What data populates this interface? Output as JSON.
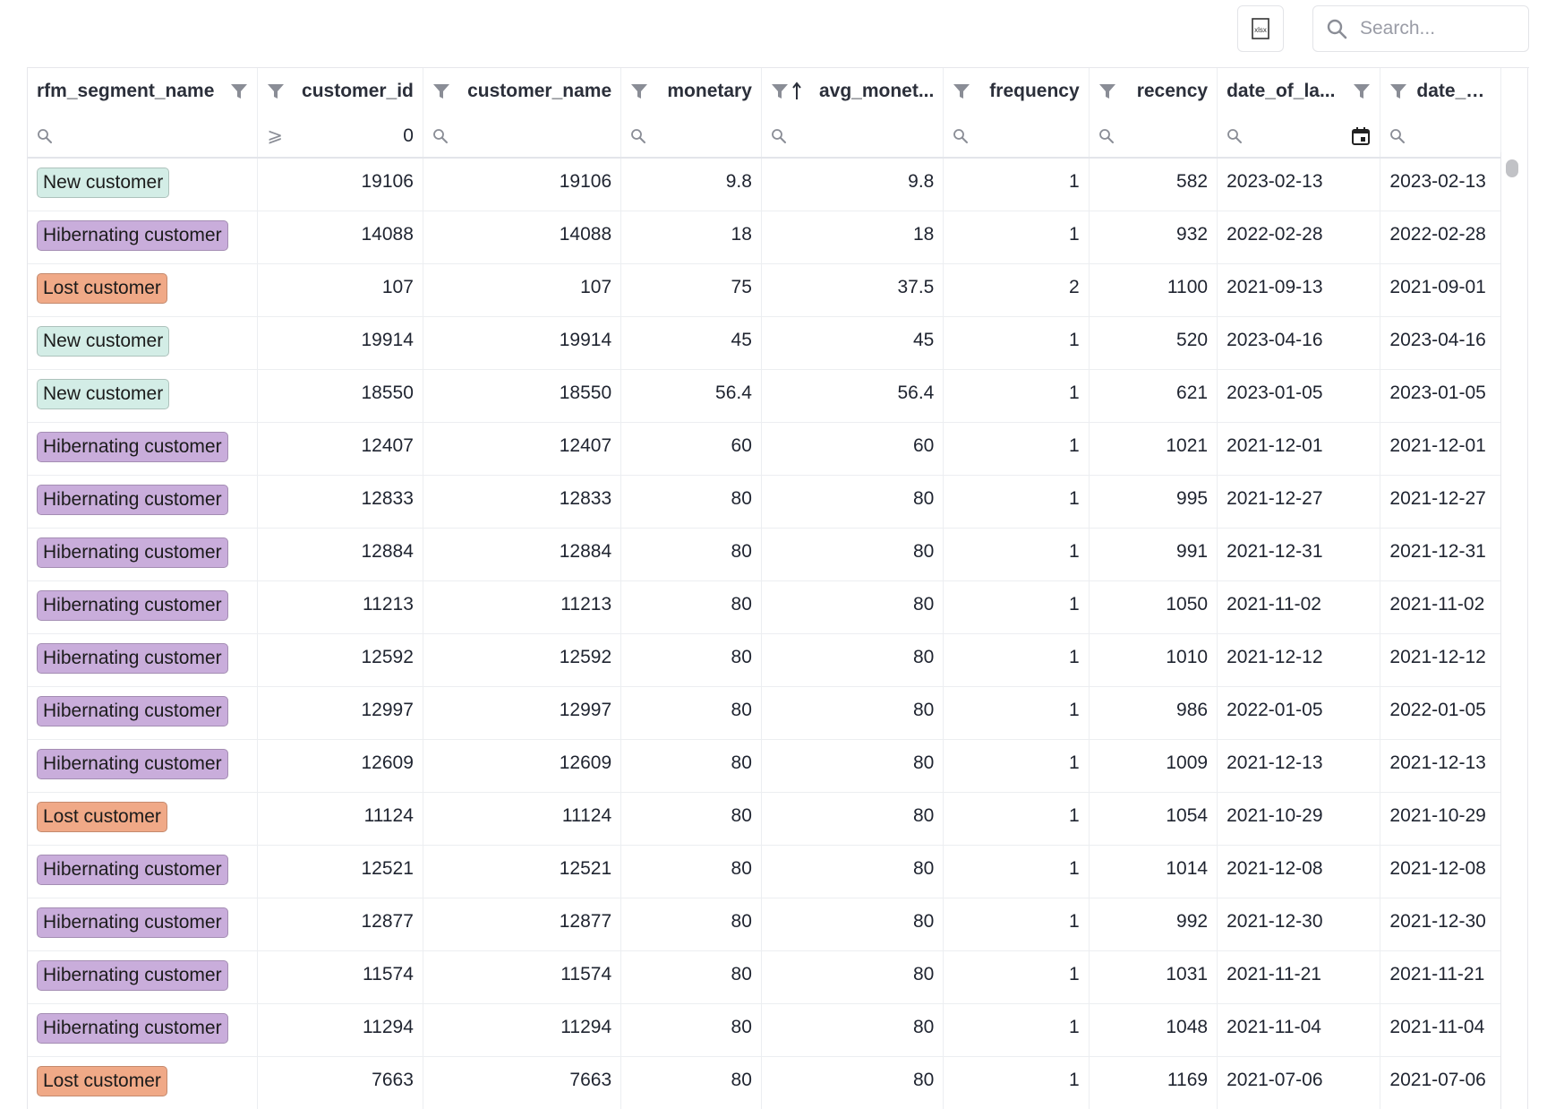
{
  "toolbar": {
    "export_icon": "xlsx-file-icon",
    "search_placeholder": "Search...",
    "search_value": ""
  },
  "columns": [
    {
      "key": "rfm_segment_name",
      "label": "rfm_segment_name",
      "align": "left",
      "filter_icon_after": true,
      "sort": ""
    },
    {
      "key": "customer_id",
      "label": "customer_id",
      "align": "right",
      "filter_icon_after": false,
      "sort": ""
    },
    {
      "key": "customer_name",
      "label": "customer_name",
      "align": "right",
      "filter_icon_after": false,
      "sort": ""
    },
    {
      "key": "monetary",
      "label": "monetary",
      "align": "right",
      "filter_icon_after": false,
      "sort": ""
    },
    {
      "key": "avg_monetary",
      "label": "avg_monet...",
      "align": "right",
      "filter_icon_after": false,
      "sort": "asc"
    },
    {
      "key": "frequency",
      "label": "frequency",
      "align": "right",
      "filter_icon_after": false,
      "sort": ""
    },
    {
      "key": "recency",
      "label": "recency",
      "align": "right",
      "filter_icon_after": false,
      "sort": ""
    },
    {
      "key": "date_of_last",
      "label": "date_of_la...",
      "align": "left",
      "filter_icon_after": true,
      "sort": ""
    },
    {
      "key": "date_of_first",
      "label": "date_of_fir...",
      "align": "left",
      "filter_icon_after": false,
      "sort": ""
    }
  ],
  "filters": [
    {
      "type": "search",
      "value": ""
    },
    {
      "type": "gte",
      "operator_symbol": "⩾",
      "value": "0"
    },
    {
      "type": "search",
      "value": ""
    },
    {
      "type": "search",
      "value": ""
    },
    {
      "type": "search",
      "value": ""
    },
    {
      "type": "search",
      "value": ""
    },
    {
      "type": "search",
      "value": ""
    },
    {
      "type": "date",
      "value": ""
    },
    {
      "type": "search",
      "value": ""
    }
  ],
  "segment_colors": {
    "New customer": "#d3ede6",
    "Hibernating customer": "#c9addb",
    "Lost customer": "#f0a987"
  },
  "rows": [
    {
      "segment": "New customer",
      "customer_id": "19106",
      "customer_name": "19106",
      "monetary": "9.8",
      "avg_monetary": "9.8",
      "frequency": "1",
      "recency": "582",
      "date_of_last": "2023-02-13",
      "date_of_first": "2023-02-13"
    },
    {
      "segment": "Hibernating customer",
      "customer_id": "14088",
      "customer_name": "14088",
      "monetary": "18",
      "avg_monetary": "18",
      "frequency": "1",
      "recency": "932",
      "date_of_last": "2022-02-28",
      "date_of_first": "2022-02-28"
    },
    {
      "segment": "Lost customer",
      "customer_id": "107",
      "customer_name": "107",
      "monetary": "75",
      "avg_monetary": "37.5",
      "frequency": "2",
      "recency": "1100",
      "date_of_last": "2021-09-13",
      "date_of_first": "2021-09-01"
    },
    {
      "segment": "New customer",
      "customer_id": "19914",
      "customer_name": "19914",
      "monetary": "45",
      "avg_monetary": "45",
      "frequency": "1",
      "recency": "520",
      "date_of_last": "2023-04-16",
      "date_of_first": "2023-04-16"
    },
    {
      "segment": "New customer",
      "customer_id": "18550",
      "customer_name": "18550",
      "monetary": "56.4",
      "avg_monetary": "56.4",
      "frequency": "1",
      "recency": "621",
      "date_of_last": "2023-01-05",
      "date_of_first": "2023-01-05"
    },
    {
      "segment": "Hibernating customer",
      "customer_id": "12407",
      "customer_name": "12407",
      "monetary": "60",
      "avg_monetary": "60",
      "frequency": "1",
      "recency": "1021",
      "date_of_last": "2021-12-01",
      "date_of_first": "2021-12-01"
    },
    {
      "segment": "Hibernating customer",
      "customer_id": "12833",
      "customer_name": "12833",
      "monetary": "80",
      "avg_monetary": "80",
      "frequency": "1",
      "recency": "995",
      "date_of_last": "2021-12-27",
      "date_of_first": "2021-12-27"
    },
    {
      "segment": "Hibernating customer",
      "customer_id": "12884",
      "customer_name": "12884",
      "monetary": "80",
      "avg_monetary": "80",
      "frequency": "1",
      "recency": "991",
      "date_of_last": "2021-12-31",
      "date_of_first": "2021-12-31"
    },
    {
      "segment": "Hibernating customer",
      "customer_id": "11213",
      "customer_name": "11213",
      "monetary": "80",
      "avg_monetary": "80",
      "frequency": "1",
      "recency": "1050",
      "date_of_last": "2021-11-02",
      "date_of_first": "2021-11-02"
    },
    {
      "segment": "Hibernating customer",
      "customer_id": "12592",
      "customer_name": "12592",
      "monetary": "80",
      "avg_monetary": "80",
      "frequency": "1",
      "recency": "1010",
      "date_of_last": "2021-12-12",
      "date_of_first": "2021-12-12"
    },
    {
      "segment": "Hibernating customer",
      "customer_id": "12997",
      "customer_name": "12997",
      "monetary": "80",
      "avg_monetary": "80",
      "frequency": "1",
      "recency": "986",
      "date_of_last": "2022-01-05",
      "date_of_first": "2022-01-05"
    },
    {
      "segment": "Hibernating customer",
      "customer_id": "12609",
      "customer_name": "12609",
      "monetary": "80",
      "avg_monetary": "80",
      "frequency": "1",
      "recency": "1009",
      "date_of_last": "2021-12-13",
      "date_of_first": "2021-12-13"
    },
    {
      "segment": "Lost customer",
      "customer_id": "11124",
      "customer_name": "11124",
      "monetary": "80",
      "avg_monetary": "80",
      "frequency": "1",
      "recency": "1054",
      "date_of_last": "2021-10-29",
      "date_of_first": "2021-10-29"
    },
    {
      "segment": "Hibernating customer",
      "customer_id": "12521",
      "customer_name": "12521",
      "monetary": "80",
      "avg_monetary": "80",
      "frequency": "1",
      "recency": "1014",
      "date_of_last": "2021-12-08",
      "date_of_first": "2021-12-08"
    },
    {
      "segment": "Hibernating customer",
      "customer_id": "12877",
      "customer_name": "12877",
      "monetary": "80",
      "avg_monetary": "80",
      "frequency": "1",
      "recency": "992",
      "date_of_last": "2021-12-30",
      "date_of_first": "2021-12-30"
    },
    {
      "segment": "Hibernating customer",
      "customer_id": "11574",
      "customer_name": "11574",
      "monetary": "80",
      "avg_monetary": "80",
      "frequency": "1",
      "recency": "1031",
      "date_of_last": "2021-11-21",
      "date_of_first": "2021-11-21"
    },
    {
      "segment": "Hibernating customer",
      "customer_id": "11294",
      "customer_name": "11294",
      "monetary": "80",
      "avg_monetary": "80",
      "frequency": "1",
      "recency": "1048",
      "date_of_last": "2021-11-04",
      "date_of_first": "2021-11-04"
    },
    {
      "segment": "Lost customer",
      "customer_id": "7663",
      "customer_name": "7663",
      "monetary": "80",
      "avg_monetary": "80",
      "frequency": "1",
      "recency": "1169",
      "date_of_last": "2021-07-06",
      "date_of_first": "2021-07-06"
    }
  ]
}
